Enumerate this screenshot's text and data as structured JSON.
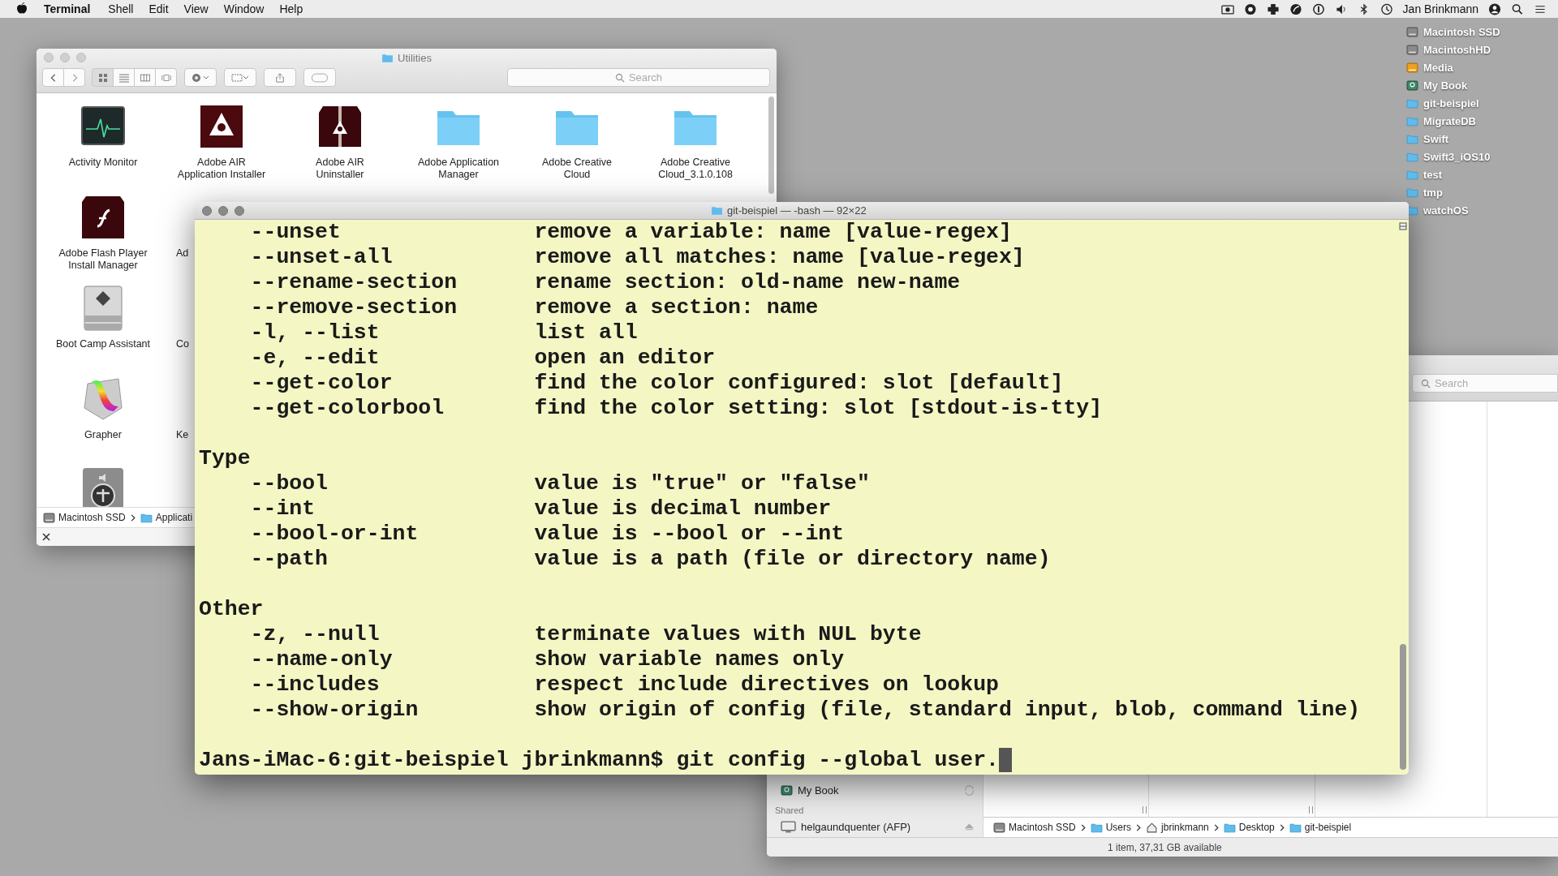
{
  "menu_bar": {
    "app_name": "Terminal",
    "menus": [
      "Shell",
      "Edit",
      "View",
      "Window",
      "Help"
    ],
    "user_name": "Jan Brinkmann"
  },
  "desktop_items": [
    {
      "label": "Macintosh SSD",
      "kind": "drive"
    },
    {
      "label": "MacintoshHD",
      "kind": "drive"
    },
    {
      "label": "Media",
      "kind": "external"
    },
    {
      "label": "My Book",
      "kind": "backup"
    },
    {
      "label": "git-beispiel",
      "kind": "folder"
    },
    {
      "label": "MigrateDB",
      "kind": "folder"
    },
    {
      "label": "Swift",
      "kind": "folder"
    },
    {
      "label": "Swift3_iOS10",
      "kind": "folder"
    },
    {
      "label": "test",
      "kind": "folder"
    },
    {
      "label": "tmp",
      "kind": "folder"
    },
    {
      "label": "watchOS",
      "kind": "folder"
    }
  ],
  "finder_window": {
    "title": "Utilities",
    "search_placeholder": "Search",
    "view_modes": [
      {
        "kind": "icons",
        "selected": true
      },
      {
        "kind": "list",
        "selected": false
      },
      {
        "kind": "columns",
        "selected": false
      },
      {
        "kind": "coverflow",
        "selected": false
      }
    ],
    "top_row": [
      {
        "label": "Activity Monitor",
        "kind": "activity"
      },
      {
        "label": "Adobe AIR Application Installer",
        "kind": "air"
      },
      {
        "label": "Adobe AIR Uninstaller",
        "kind": "air-box"
      },
      {
        "label": "Adobe Application Manager",
        "kind": "folder"
      },
      {
        "label": "Adobe Creative Cloud",
        "kind": "folder"
      },
      {
        "label": "Adobe Creative Cloud_3.1.0.108",
        "kind": "folder"
      }
    ],
    "left_column": [
      {
        "label": "Adobe Flash Player Install Manager",
        "kind": "flash",
        "covered_neighbor": "Ad"
      },
      {
        "label": "Boot Camp Assistant",
        "kind": "bootcamp",
        "covered_neighbor": "Co"
      },
      {
        "label": "Grapher",
        "kind": "grapher",
        "covered_neighbor": "Ke"
      },
      {
        "kind": "accessibility"
      }
    ],
    "path": [
      {
        "label": "Macintosh SSD",
        "kind": "drive"
      },
      {
        "label": "Applicati",
        "kind": "apps"
      }
    ]
  },
  "terminal": {
    "title": "git-beispiel — -bash — 92×22",
    "lines": [
      {
        "kind": "option",
        "flag": "--unset",
        "description": "remove a variable: name [value-regex]"
      },
      {
        "kind": "option",
        "flag": "--unset-all",
        "description": "remove all matches: name [value-regex]"
      },
      {
        "kind": "option",
        "flag": "--rename-section",
        "description": "rename section: old-name new-name"
      },
      {
        "kind": "option",
        "flag": "--remove-section",
        "description": "remove a section: name"
      },
      {
        "kind": "option",
        "flag": "-l, --list",
        "description": "list all"
      },
      {
        "kind": "option",
        "flag": "-e, --edit",
        "description": "open an editor"
      },
      {
        "kind": "option",
        "flag": "--get-color",
        "description": "find the color configured: slot [default]"
      },
      {
        "kind": "option",
        "flag": "--get-colorbool",
        "description": "find the color setting: slot [stdout-is-tty]"
      },
      {
        "kind": "blank"
      },
      {
        "kind": "heading",
        "text": "Type"
      },
      {
        "kind": "option",
        "flag": "--bool",
        "description": "value is \"true\" or \"false\""
      },
      {
        "kind": "option",
        "flag": "--int",
        "description": "value is decimal number"
      },
      {
        "kind": "option",
        "flag": "--bool-or-int",
        "description": "value is --bool or --int"
      },
      {
        "kind": "option",
        "flag": "--path",
        "description": "value is a path (file or directory name)"
      },
      {
        "kind": "blank"
      },
      {
        "kind": "heading",
        "text": "Other"
      },
      {
        "kind": "option",
        "flag": "-z, --null",
        "description": "terminate values with NUL byte"
      },
      {
        "kind": "option",
        "flag": "--name-only",
        "description": "show variable names only"
      },
      {
        "kind": "option",
        "flag": "--includes",
        "description": "respect include directives on lookup"
      },
      {
        "kind": "option",
        "flag": "--show-origin",
        "description": "show origin of config (file, standard input, blob, command line)"
      },
      {
        "kind": "blank"
      },
      {
        "kind": "prompt",
        "text": "Jans-iMac-6:git-beispiel jbrinkmann$ git config --global user."
      }
    ]
  },
  "finder_window_2": {
    "search_placeholder": "Search",
    "devices": [
      {
        "label": "My Book",
        "kind": "backup"
      }
    ],
    "shared_heading": "Shared",
    "shared": [
      {
        "label": "helgaundquenter (AFP)",
        "kind": "server"
      }
    ],
    "path": [
      {
        "label": "Macintosh SSD",
        "kind": "drive"
      },
      {
        "label": "Users",
        "kind": "folder"
      },
      {
        "label": "jbrinkmann",
        "kind": "home"
      },
      {
        "label": "Desktop",
        "kind": "folder"
      },
      {
        "label": "git-beispiel",
        "kind": "folder"
      }
    ],
    "status": "1 item, 37,31 GB available"
  }
}
